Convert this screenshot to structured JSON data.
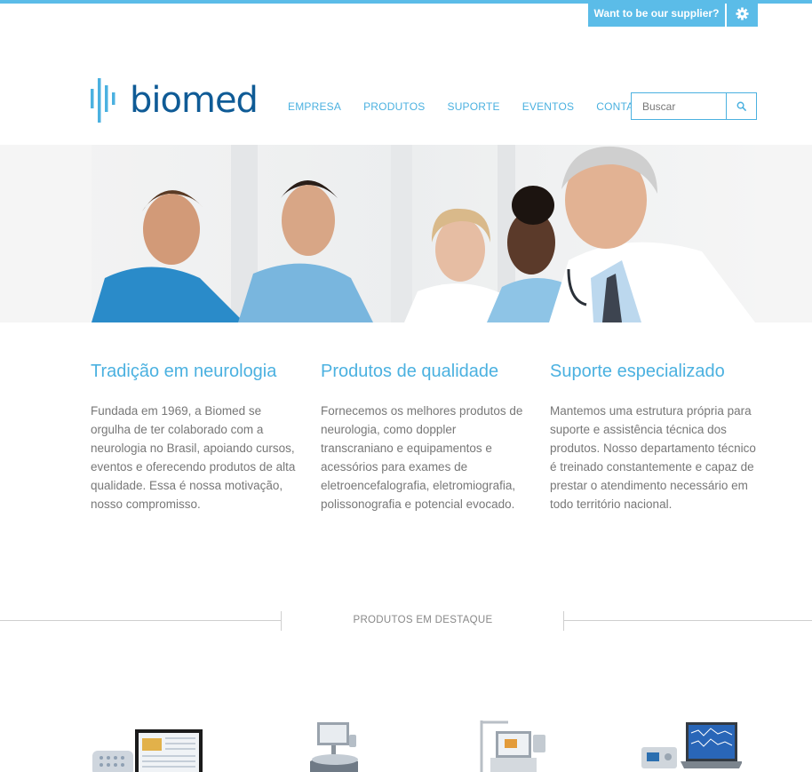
{
  "topbar": {
    "supplier_label": "Want to be our supplier?",
    "gear_icon": "gear-icon"
  },
  "brand": {
    "logo_text": "biomed",
    "color": "#0f5b96",
    "accent": "#4bb1e0"
  },
  "nav": {
    "items": [
      {
        "label": "EMPRESA"
      },
      {
        "label": "PRODUTOS"
      },
      {
        "label": "SUPORTE"
      },
      {
        "label": "EVENTOS"
      },
      {
        "label": "CONTATO"
      }
    ]
  },
  "search": {
    "placeholder": "Buscar",
    "icon": "search-icon"
  },
  "features": [
    {
      "title": "Tradição em neurologia",
      "text": "Fundada em 1969, a Biomed se orgulha de ter colaborado com a neurologia no Brasil, apoiando cursos, eventos e oferecendo produtos de alta qualidade. Essa é nossa motivação, nosso compromisso."
    },
    {
      "title": "Produtos de qualidade",
      "text": "Fornecemos os melhores produtos de neurologia, como doppler transcraniano e equipamentos e acessórios para exames de eletroencefalografia, eletromiografia, polissonografia e potencial evocado."
    },
    {
      "title": "Suporte especializado",
      "text": "Mantemos uma estrutura própria para suporte e assistência técnica dos produtos. Nosso departamento técnico é treinado constantemente e capaz de prestar o atendimento necessário em todo território nacional."
    }
  ],
  "featured": {
    "title": "PRODUTOS EM DESTAQUE"
  }
}
